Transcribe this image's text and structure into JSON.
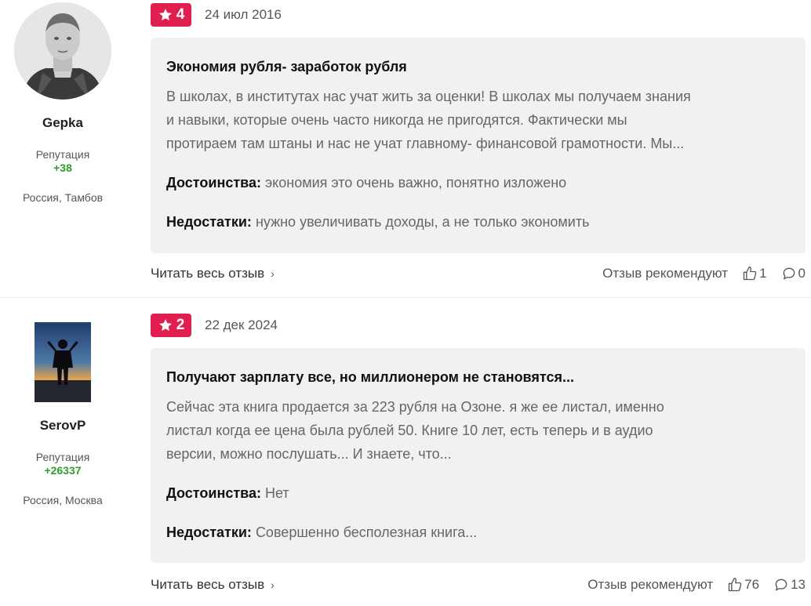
{
  "reviews": [
    {
      "author": {
        "name": "Gepka",
        "rep_label": "Репутация",
        "rep_value": "+38",
        "location": "Россия, Тамбов",
        "avatar": "person-portrait"
      },
      "rating": "4",
      "date": "24 июл 2016",
      "title": "Экономия рубля- заработок рубля",
      "body": [
        "В школах, в институтах нас учат жить за оценки! В школах мы получаем знания",
        "и навыки, которые очень часто никогда не пригодятся. Фактически мы",
        "протираем там штаны и нас не учат главному- финансовой грамотности. Мы..."
      ],
      "pros_label": "Достоинства:",
      "pros": "экономия это очень важно, понятно изложено",
      "cons_label": "Недостатки:",
      "cons": "нужно увеличивать доходы, а не только экономить",
      "read_more": "Читать весь отзыв",
      "recommend": "Отзыв рекомендуют",
      "likes": "1",
      "comments": "0"
    },
    {
      "author": {
        "name": "SerovP",
        "rep_label": "Репутация",
        "rep_value": "+26337",
        "location": "Россия, Москва",
        "avatar": "silhouette-sunset"
      },
      "rating": "2",
      "date": "22 дек 2024",
      "title": "Получают зарплату все, но миллионером не становятся...",
      "body": [
        "Сейчас эта книга продается за 223 рубля на Озоне. я же ее листал, именно",
        "листал когда ее цена была рублей 50. Книге 10 лет, есть теперь и в аудио",
        "версии, можно послушать... И знаете, что..."
      ],
      "pros_label": "Достоинства:",
      "pros": "Нет",
      "cons_label": "Недостатки:",
      "cons": "Совершенно бесполезная книга...",
      "read_more": "Читать весь отзыв",
      "recommend": "Отзыв рекомендуют",
      "likes": "76",
      "comments": "13"
    }
  ],
  "icons": {
    "rating": "star-icon",
    "more": "chevron-right-icon",
    "like": "thumbs-up-icon",
    "comment": "comment-icon"
  },
  "colors": {
    "badge": "#e01e50",
    "reputation": "#2e9c2e",
    "card": "#f1f1f4"
  }
}
